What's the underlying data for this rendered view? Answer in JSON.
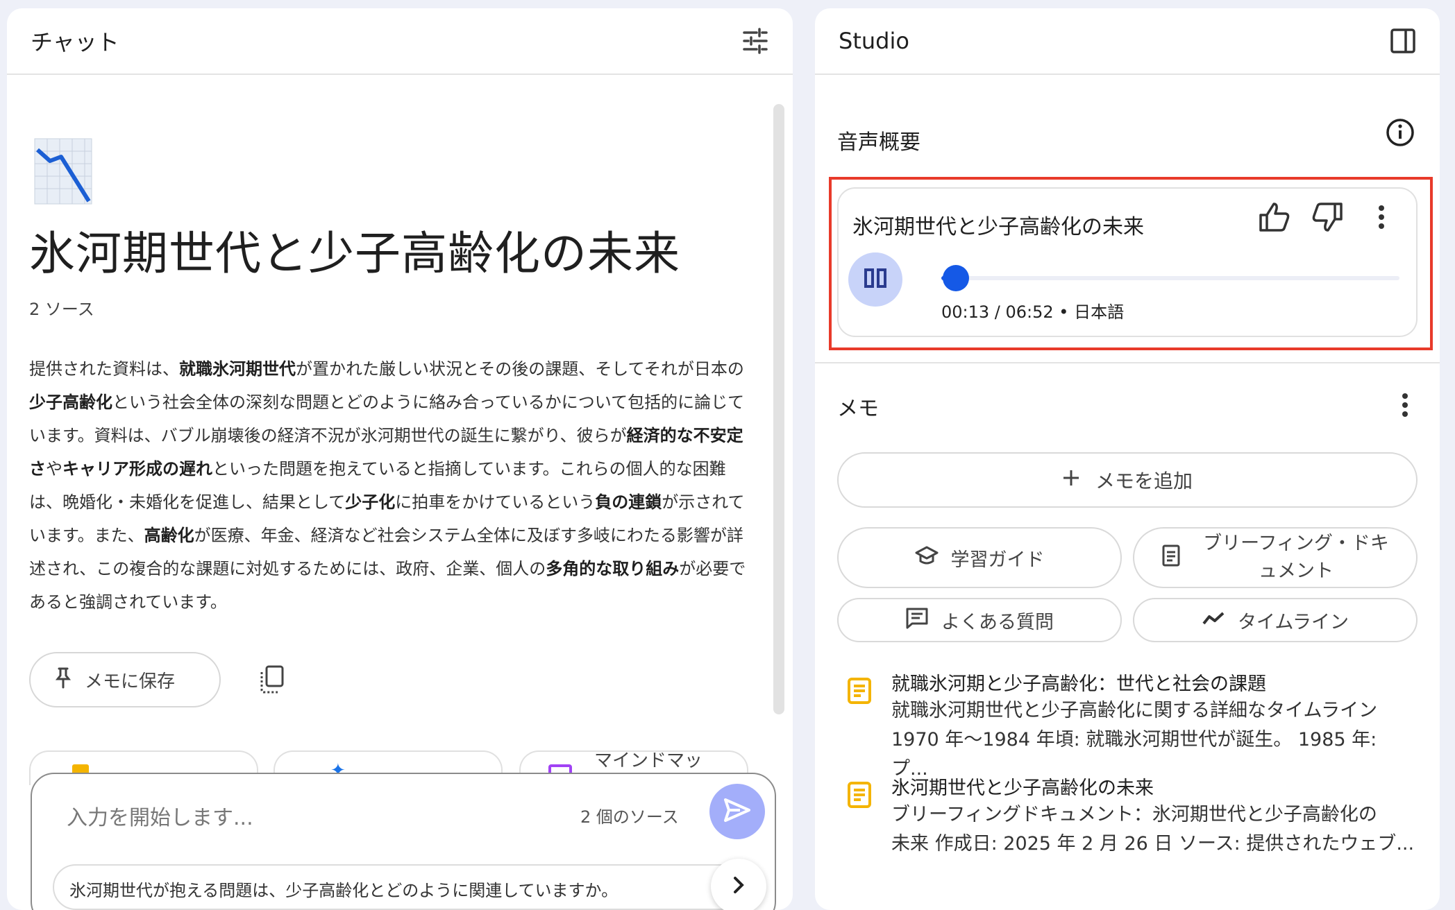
{
  "chat": {
    "header_title": "チャット",
    "notebook_emoji": "📉",
    "notebook_title": "氷河期世代と少子高齢化の未来",
    "source_count": "2 ソース",
    "summary_parts": [
      {
        "text": "提供された資料は、",
        "bold": false
      },
      {
        "text": "就職氷河期世代",
        "bold": true
      },
      {
        "text": "が置かれた厳しい状況とその後の課題、そしてそれが日本の",
        "bold": false
      },
      {
        "text": "少子高齢化",
        "bold": true
      },
      {
        "text": "という社会全体の深刻な問題とどのように絡み合っているかについて包括的に論じています。資料は、バブル崩壊後の経済不況が氷河期世代の誕生に繋がり、彼らが",
        "bold": false
      },
      {
        "text": "経済的な不安定さ",
        "bold": true
      },
      {
        "text": "や",
        "bold": false
      },
      {
        "text": "キャリア形成の遅れ",
        "bold": true
      },
      {
        "text": "といった問題を抱えていると指摘しています。これらの個人的な困難は、晩婚化・未婚化を促進し、結果として",
        "bold": false
      },
      {
        "text": "少子化",
        "bold": true
      },
      {
        "text": "に拍車をかけているという",
        "bold": false
      },
      {
        "text": "負の連鎖",
        "bold": true
      },
      {
        "text": "が示されています。また、",
        "bold": false
      },
      {
        "text": "高齢化",
        "bold": true
      },
      {
        "text": "が医療、年金、経済など社会システム全体に及ぼす多岐にわたる影響が詳述され、この複合的な課題に対処するためには、政府、企業、個人の",
        "bold": false
      },
      {
        "text": "多角的な取り組み",
        "bold": true
      },
      {
        "text": "が必要であると強調されています。",
        "bold": false
      }
    ],
    "save_memo_label": "メモに保存",
    "chips": [
      {
        "label": "",
        "icon": "doc-icon",
        "color": "#f4b400"
      },
      {
        "label": "",
        "icon": "sparkle-icon",
        "color": "#1a73e8"
      },
      {
        "label": "マインドマッ",
        "icon": "mindmap-icon",
        "color": "#a142f4"
      }
    ],
    "input_placeholder": "入力を開始します...",
    "input_source_count": "2 個のソース",
    "suggestion": "氷河期世代が抱える問題は、少子高齢化とどのように関連していますか。"
  },
  "studio": {
    "header_title": "Studio",
    "audio_section_title": "音声概要",
    "audio": {
      "title": "氷河期世代と少子高齢化の未来",
      "time": "00:13 / 06:52 • 日本語",
      "progress": 0.032
    },
    "memo_section_title": "メモ",
    "add_memo_label": "メモを追加",
    "tools": {
      "study_guide": "学習ガイド",
      "briefing_line1": "ブリーフィング・ドキ",
      "briefing_line2": "ュメント",
      "faq": "よくある質問",
      "timeline": "タイムライン"
    },
    "notes": [
      {
        "title": "就職氷河期と少子高齢化：世代と社会の課題",
        "line1": "就職氷河期世代と少子高齢化に関する詳細なタイムライン",
        "line2": "1970 年～1984 年頃: 就職氷河期世代が誕生。 1985 年: プ..."
      },
      {
        "title": "氷河期世代と少子高齢化の未来",
        "line1": "ブリーフィングドキュメント：氷河期世代と少子高齢化の",
        "line2": "未来 作成日: 2025 年 2 月 26 日 ソース: 提供されたウェブ..."
      }
    ],
    "accent_color": "#1559e6",
    "highlight_color": "#e83a2a"
  }
}
